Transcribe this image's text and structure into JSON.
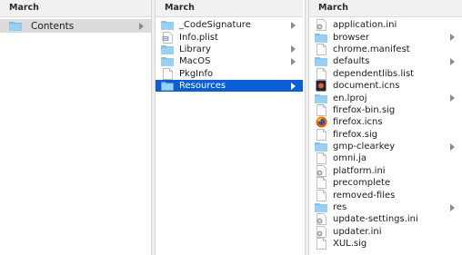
{
  "columns": [
    {
      "header": "March",
      "items": [
        {
          "label": "Contents",
          "icon": "folder-icon",
          "has_children": true,
          "selected": "inactive"
        }
      ]
    },
    {
      "header": "March",
      "items": [
        {
          "label": "_CodeSignature",
          "icon": "folder-icon",
          "has_children": true
        },
        {
          "label": "Info.plist",
          "icon": "plist-file-icon",
          "has_children": false
        },
        {
          "label": "Library",
          "icon": "folder-icon",
          "has_children": true
        },
        {
          "label": "MacOS",
          "icon": "folder-icon",
          "has_children": true
        },
        {
          "label": "PkgInfo",
          "icon": "file-icon",
          "has_children": false
        },
        {
          "label": "Resources",
          "icon": "folder-icon",
          "has_children": true,
          "selected": "active"
        }
      ]
    },
    {
      "header": "March",
      "items": [
        {
          "label": "application.ini",
          "icon": "settings-file-icon",
          "has_children": false
        },
        {
          "label": "browser",
          "icon": "folder-icon",
          "has_children": true
        },
        {
          "label": "chrome.manifest",
          "icon": "file-icon",
          "has_children": false
        },
        {
          "label": "defaults",
          "icon": "folder-icon",
          "has_children": true
        },
        {
          "label": "dependentlibs.list",
          "icon": "file-icon",
          "has_children": false
        },
        {
          "label": "document.icns",
          "icon": "dark-icns-file-icon",
          "has_children": false
        },
        {
          "label": "en.lproj",
          "icon": "folder-icon",
          "has_children": true
        },
        {
          "label": "firefox-bin.sig",
          "icon": "file-icon",
          "has_children": false
        },
        {
          "label": "firefox.icns",
          "icon": "firefox-icon",
          "has_children": false
        },
        {
          "label": "firefox.sig",
          "icon": "file-icon",
          "has_children": false
        },
        {
          "label": "gmp-clearkey",
          "icon": "folder-icon",
          "has_children": true
        },
        {
          "label": "omni.ja",
          "icon": "file-icon",
          "has_children": false
        },
        {
          "label": "platform.ini",
          "icon": "settings-file-icon",
          "has_children": false
        },
        {
          "label": "precomplete",
          "icon": "file-icon",
          "has_children": false
        },
        {
          "label": "removed-files",
          "icon": "file-icon",
          "has_children": false
        },
        {
          "label": "res",
          "icon": "folder-icon",
          "has_children": true
        },
        {
          "label": "update-settings.ini",
          "icon": "settings-file-icon",
          "has_children": false
        },
        {
          "label": "updater.ini",
          "icon": "settings-file-icon",
          "has_children": false
        },
        {
          "label": "XUL.sig",
          "icon": "file-icon",
          "has_children": false
        }
      ]
    }
  ],
  "colors": {
    "selection_active": "#0a5fd6",
    "selection_inactive": "#dcdcdc",
    "folder": "#7fc0ec"
  }
}
